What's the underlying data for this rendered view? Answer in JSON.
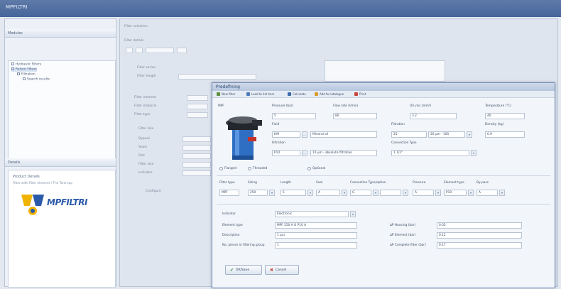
{
  "window": {
    "title": "MPFILTRI"
  },
  "left_panel": {
    "header_top": "Modules",
    "tree_items": [
      {
        "label": "Hydraulic Filters",
        "selected": false
      },
      {
        "label": "Return Filters",
        "selected": true
      },
      {
        "label": "Filtration",
        "selected": false
      },
      {
        "label": "Search results",
        "selected": false
      }
    ],
    "header_bottom": "Details",
    "product_title": "Product Details",
    "product_desc": "Filter with Filter element / The Tank top",
    "logo_text": "MPFILTRI"
  },
  "background_form": {
    "header": "Filter selection",
    "subheader": "Filter details",
    "labels": [
      "Filter series",
      "Filter length",
      "Filter element",
      "Filter material",
      "Filter type",
      "Filter size",
      "Bypass",
      "Seals",
      "Port",
      "Filter size",
      "Indicator"
    ],
    "button": "Configure"
  },
  "dialog": {
    "title": "Predefining",
    "toolbar": [
      {
        "label": "New filter",
        "color": "#5d8f3d"
      },
      {
        "label": "Load to list item",
        "color": "#4a79b8"
      },
      {
        "label": "Calculate",
        "color": "#3a6aa8"
      },
      {
        "label": "Add to catalogue",
        "color": "#d89b2b"
      },
      {
        "label": "Print",
        "color": "#c8453a"
      }
    ],
    "section_label": "MPF",
    "top_fields": [
      {
        "label": "Pressure (bar)",
        "value": "5"
      },
      {
        "label": "Flow rate (l/min)",
        "value": "80"
      },
      {
        "label": "Oil visc.(mm²)",
        "value": "3.2"
      },
      {
        "label": "Temperature (°C)",
        "value": "40"
      }
    ],
    "fluid": {
      "label": "Fluid",
      "code": "HM",
      "value": "Mineral oil"
    },
    "filtration": {
      "label": "Filtration",
      "code": "25",
      "value": "20 µm - 105"
    },
    "density": {
      "label": "Density (kg)",
      "value": "0.9"
    },
    "element": {
      "label": "Filtration",
      "code": "P10",
      "value": "10 µm - absolute filtration"
    },
    "connection": {
      "label": "Connection Type",
      "value": "1 1/2\""
    },
    "radio_options": [
      "Flanged",
      "Threaded",
      "Optional"
    ],
    "sub_fields": [
      {
        "label": "Filter type",
        "value": "MPF"
      },
      {
        "label": "Sizing",
        "value": "250"
      },
      {
        "label": "Length",
        "value": "5"
      },
      {
        "label": "Seal",
        "value": "A"
      },
      {
        "label": "Connection Type/option",
        "value": "G"
      },
      {
        "label": "Pressure",
        "value": "A"
      },
      {
        "label": "Element type",
        "value": "P10"
      },
      {
        "label": "By-pass",
        "value": "A"
      }
    ],
    "lower_left": {
      "indicator_label": "Indicator",
      "indicator_value": "Electronic",
      "rows": [
        {
          "label": "Element type",
          "value": "MPF 250 A G P10 A"
        },
        {
          "label": "Description",
          "value": "1 pcs"
        },
        {
          "label": "No. pieces in filtering group",
          "value": "1"
        }
      ]
    },
    "lower_right": [
      {
        "label": "∆P Housing (bar)",
        "value": "0.05"
      },
      {
        "label": "∆P Element (bar)",
        "value": "0.12"
      },
      {
        "label": "∆P Complete filter (bar)",
        "value": "0.17"
      }
    ],
    "buttons": {
      "ok": "OK/Save",
      "cancel": "Cancel"
    }
  },
  "colors": {
    "titlebar": "#4f6ea0",
    "accent": "#2a5fb0",
    "logo_yellow": "#f0b400",
    "logo_blue": "#2b5aa8"
  }
}
